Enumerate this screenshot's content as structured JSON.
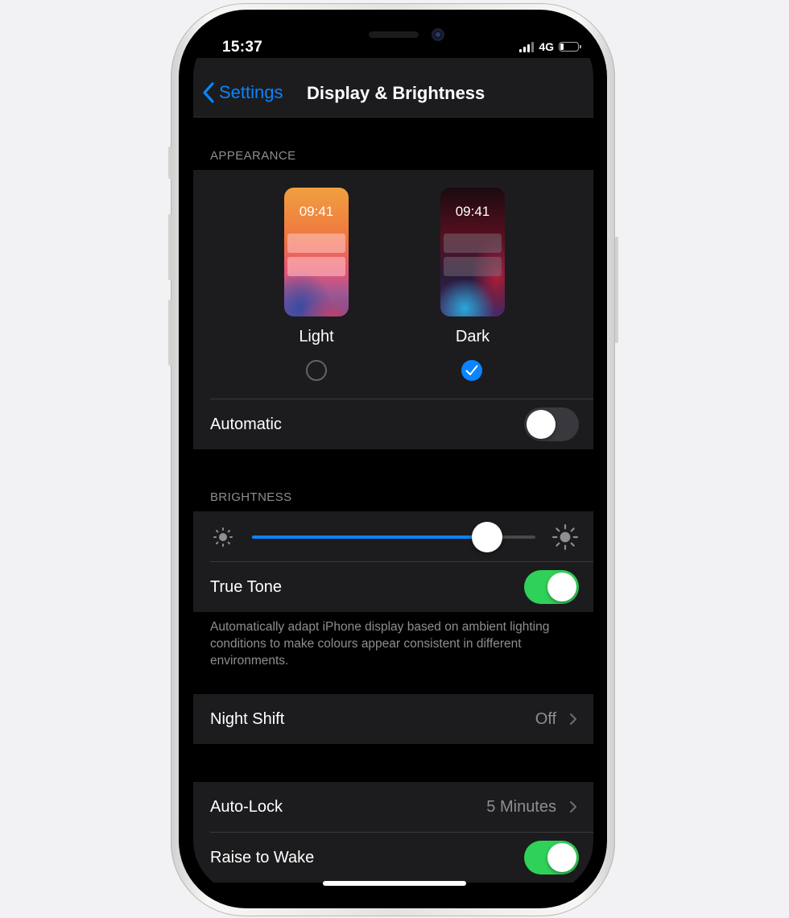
{
  "status_bar": {
    "time": "15:37",
    "network": "4G",
    "signal_bars_active": 3,
    "battery_level": 0.2
  },
  "nav": {
    "back_label": "Settings",
    "title": "Display & Brightness"
  },
  "appearance": {
    "header": "APPEARANCE",
    "options": [
      {
        "label": "Light",
        "time": "09:41",
        "selected": false
      },
      {
        "label": "Dark",
        "time": "09:41",
        "selected": true
      }
    ],
    "automatic": {
      "label": "Automatic",
      "on": false
    }
  },
  "brightness": {
    "header": "BRIGHTNESS",
    "level": 0.83,
    "true_tone": {
      "label": "True Tone",
      "on": true
    },
    "footer": "Automatically adapt iPhone display based on ambient lighting conditions to make colours appear consistent in different environments."
  },
  "night_shift": {
    "label": "Night Shift",
    "value": "Off"
  },
  "auto_lock": {
    "label": "Auto-Lock",
    "value": "5 Minutes"
  },
  "raise_to_wake": {
    "label": "Raise to Wake",
    "on": true
  },
  "colors": {
    "accent": "#0a84ff",
    "toggle_on": "#30d158",
    "background": "#000000",
    "cell": "#1c1c1e",
    "secondary_text": "#8e8e93"
  },
  "icons": [
    "chevron-left-icon",
    "checkmark-icon",
    "sun-small-icon",
    "sun-large-icon",
    "chevron-right-icon",
    "battery-icon",
    "signal-icon"
  ]
}
